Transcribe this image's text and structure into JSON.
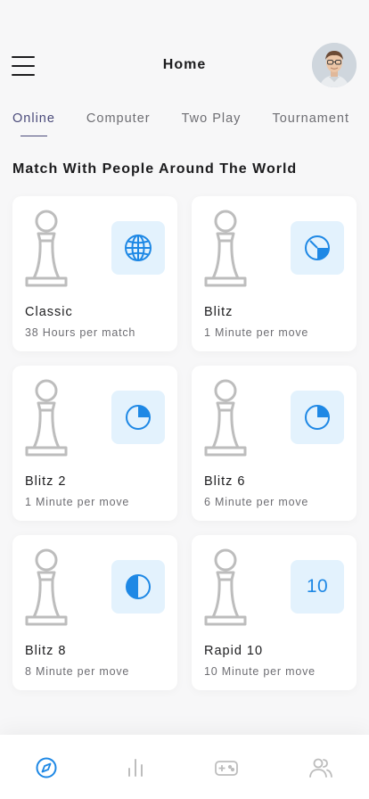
{
  "header": {
    "title": "Home",
    "menu_icon": "hamburger-menu-icon",
    "avatar": "user-avatar"
  },
  "tabs": [
    {
      "label": "Online",
      "active": true
    },
    {
      "label": "Computer",
      "active": false
    },
    {
      "label": "Two Play",
      "active": false
    },
    {
      "label": "Tournament",
      "active": false
    }
  ],
  "section_title": "Match With People Around The World",
  "cards": [
    {
      "name": "Classic",
      "subtitle": "38 Hours per match",
      "icon": "globe-icon"
    },
    {
      "name": "Blitz",
      "subtitle": "1 Minute per move",
      "icon": "timer-quarter-icon"
    },
    {
      "name": "Blitz 2",
      "subtitle": "1 Minute per move",
      "icon": "timer-quarter-icon"
    },
    {
      "name": "Blitz 6",
      "subtitle": "6 Minute per move",
      "icon": "timer-quarter-icon"
    },
    {
      "name": "Blitz 8",
      "subtitle": "8 Minute per move",
      "icon": "timer-half-icon"
    },
    {
      "name": "Rapid 10",
      "subtitle": "10 Minute per move",
      "icon": "number-badge",
      "badge_text": "10"
    }
  ],
  "bottom_nav": [
    {
      "icon": "compass-icon",
      "active": true
    },
    {
      "icon": "bar-chart-icon",
      "active": false
    },
    {
      "icon": "gamepad-icon",
      "active": false
    },
    {
      "icon": "users-icon",
      "active": false
    }
  ],
  "colors": {
    "accent": "#1e88e5",
    "badge_bg": "#e3f2fd",
    "tab_active": "#4a4a7a",
    "pawn": "#bdbdbd"
  }
}
